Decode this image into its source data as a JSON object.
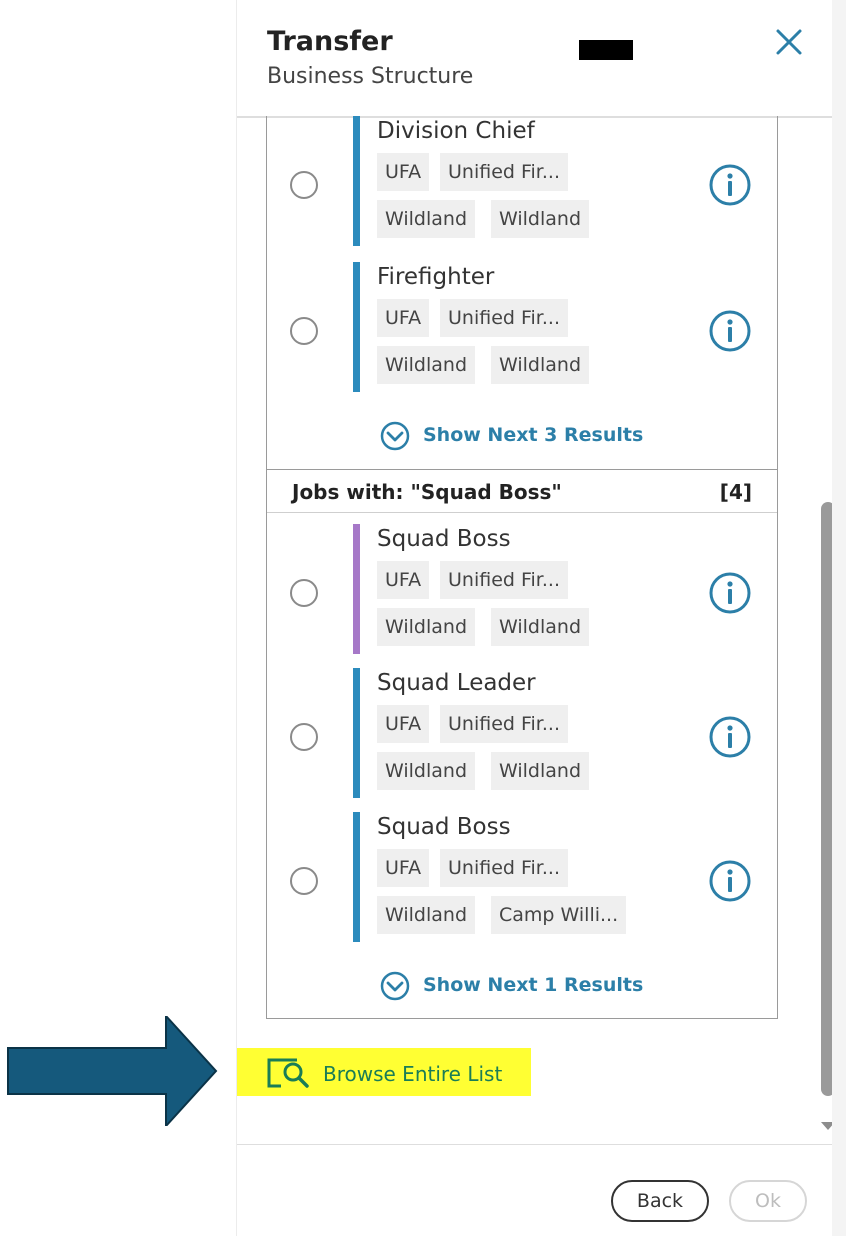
{
  "header": {
    "title": "Transfer",
    "subtitle": "Business Structure"
  },
  "colors": {
    "accent": "#2c7fa8",
    "bar_blue": "#2c8bbd",
    "bar_purple": "#a678c8",
    "highlight": "#ffff33",
    "browse_text": "#1a7d56",
    "arrow": "#15597c"
  },
  "top_section": {
    "jobs": [
      {
        "title": "Division Chief",
        "tags": [
          "UFA",
          "Unified Fir...",
          "Wildland",
          "Wildland"
        ],
        "bar_color": "blue"
      },
      {
        "title": "Firefighter",
        "tags": [
          "UFA",
          "Unified Fir...",
          "Wildland",
          "Wildland"
        ],
        "bar_color": "blue"
      }
    ],
    "show_next": "Show Next 3 Results"
  },
  "squad_section": {
    "header_label": "Jobs with: \"Squad Boss\"",
    "count": "[4]",
    "jobs": [
      {
        "title": "Squad Boss",
        "tags": [
          "UFA",
          "Unified Fir...",
          "Wildland",
          "Wildland"
        ],
        "bar_color": "purple"
      },
      {
        "title": "Squad Leader",
        "tags": [
          "UFA",
          "Unified Fir...",
          "Wildland",
          "Wildland"
        ],
        "bar_color": "blue"
      },
      {
        "title": "Squad Boss",
        "tags": [
          "UFA",
          "Unified Fir...",
          "Wildland",
          "Camp Willi..."
        ],
        "bar_color": "blue"
      }
    ],
    "show_next": "Show Next 1 Results"
  },
  "browse": {
    "label": "Browse Entire List",
    "icon": "browse-search-icon"
  },
  "footer": {
    "back_label": "Back",
    "ok_label": "Ok"
  },
  "icons": {
    "close": "close-icon",
    "info": "info-icon",
    "show_next": "chevron-down-circle-icon",
    "annotation_arrow": "arrow-right-icon"
  }
}
